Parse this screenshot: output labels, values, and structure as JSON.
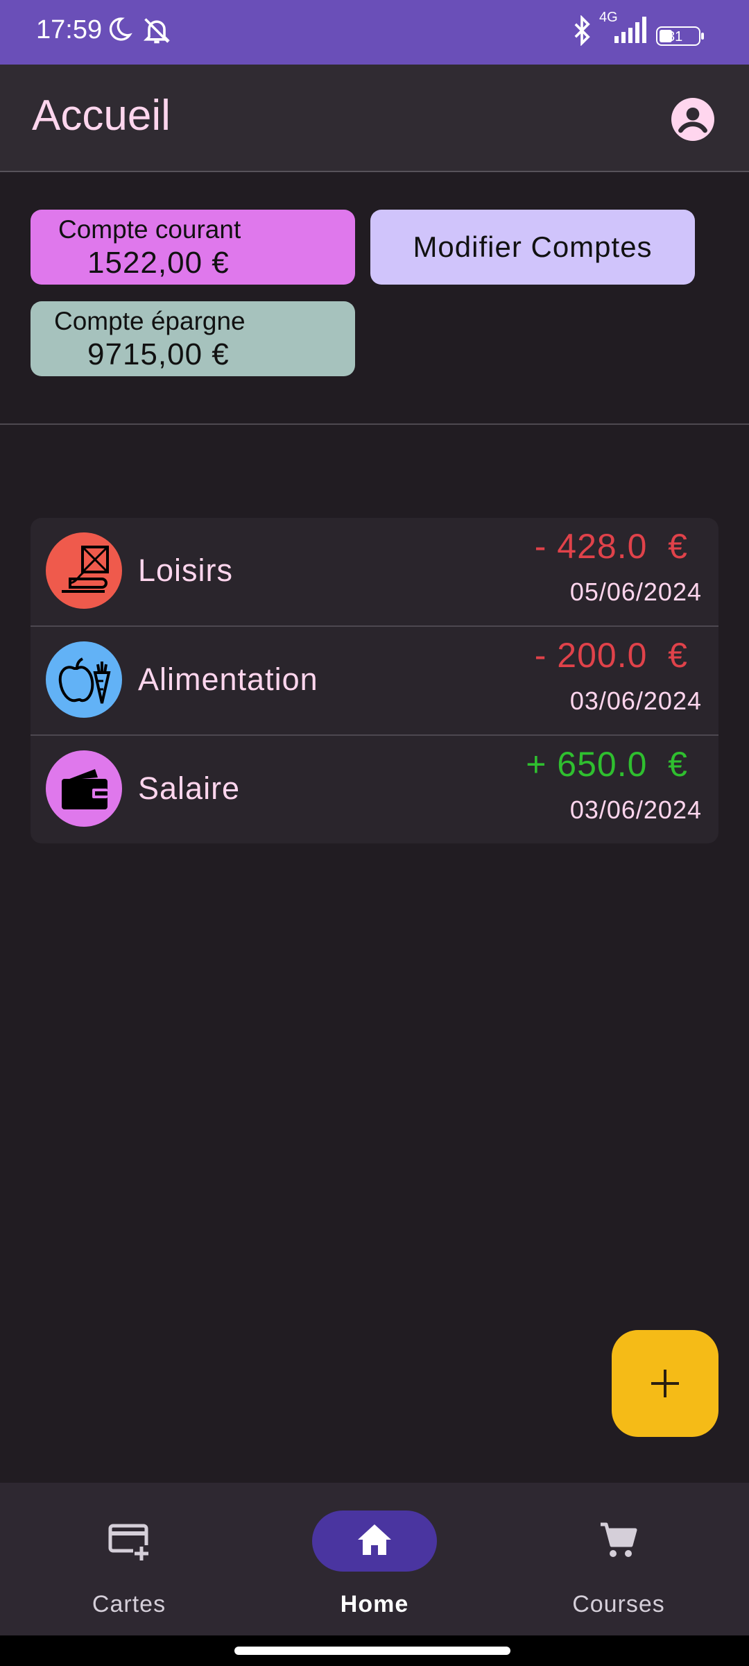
{
  "status_bar": {
    "time": "17:59",
    "network": "4G",
    "battery": "31",
    "icons": [
      "moon-icon",
      "silent-icon",
      "bluetooth-icon",
      "signal-icon",
      "battery-icon"
    ]
  },
  "header": {
    "title": "Accueil",
    "account_icon": "account-circle-icon"
  },
  "accounts": [
    {
      "name": "Compte courant",
      "amount": "1522,00 €",
      "color": "#df78ec"
    },
    {
      "name": "Compte épargne",
      "amount": "9715,00 €",
      "color": "#a6c2bd"
    }
  ],
  "modify_accounts_label": "Modifier Comptes",
  "transactions": [
    {
      "label": "Loisirs",
      "amount": "- 428.0  €",
      "date": "05/06/2024",
      "sign": "negative",
      "icon": "kite-icon",
      "icon_color": "#ef5a4c"
    },
    {
      "label": "Alimentation",
      "amount": "- 200.0  €",
      "date": "03/06/2024",
      "sign": "negative",
      "icon": "fruit-vegetable-icon",
      "icon_color": "#62b2f6"
    },
    {
      "label": "Salaire",
      "amount": "+ 650.0  €",
      "date": "03/06/2024",
      "sign": "positive",
      "icon": "wallet-icon",
      "icon_color": "#df78ec"
    }
  ],
  "fab_icon": "plus-icon",
  "bottom_nav": [
    {
      "label": "Cartes",
      "icon": "add-card-icon",
      "active": false
    },
    {
      "label": "Home",
      "icon": "home-icon",
      "active": true
    },
    {
      "label": "Courses",
      "icon": "cart-icon",
      "active": false
    }
  ],
  "colors": {
    "status_bar": "#6a4fb8",
    "background": "#211c22",
    "negative": "#e0424a",
    "positive": "#2fbf2f",
    "fab": "#f5bb17",
    "nav_active": "#4a35a0"
  }
}
